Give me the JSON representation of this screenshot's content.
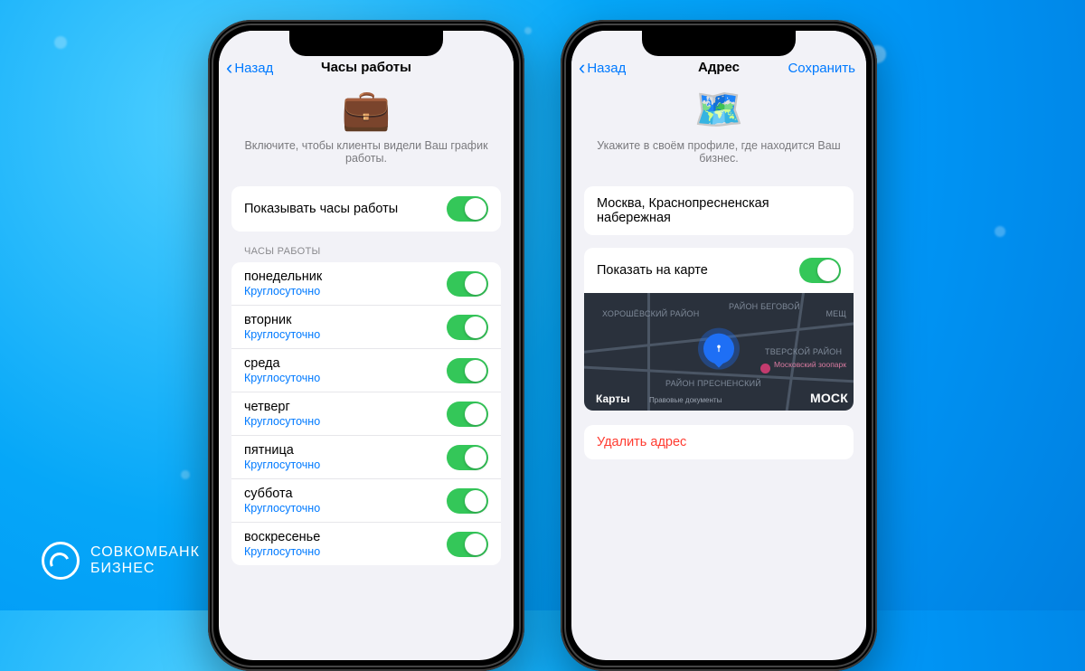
{
  "branding": {
    "name": "СОВКОМБАНК",
    "sub": "БИЗНЕС"
  },
  "phone1": {
    "nav": {
      "back": "Назад",
      "title": "Часы работы"
    },
    "hero": {
      "icon": "💼",
      "text": "Включите, чтобы клиенты видели Ваш график работы."
    },
    "toggle_label": "Показывать часы работы",
    "section_label": "ЧАСЫ РАБОТЫ",
    "days": [
      {
        "name": "понедельник",
        "sub": "Круглосуточно"
      },
      {
        "name": "вторник",
        "sub": "Круглосуточно"
      },
      {
        "name": "среда",
        "sub": "Круглосуточно"
      },
      {
        "name": "четверг",
        "sub": "Круглосуточно"
      },
      {
        "name": "пятница",
        "sub": "Круглосуточно"
      },
      {
        "name": "суббота",
        "sub": "Круглосуточно"
      },
      {
        "name": "воскресенье",
        "sub": "Круглосуточно"
      }
    ]
  },
  "phone2": {
    "nav": {
      "back": "Назад",
      "title": "Адрес",
      "save": "Сохранить"
    },
    "hero": {
      "icon": "🗺️",
      "text": "Укажите в своём профиле, где находится Ваш бизнес."
    },
    "address": "Москва, Краснопресненская набережная",
    "map_toggle": "Показать на карте",
    "map": {
      "brand": "Карты",
      "fine": "Правовые документы",
      "city": "Моск",
      "districts": [
        "ХОРОШЁВСКИЙ РАЙОН",
        "РАЙОН БЕГОВОЙ",
        "ТВЕРСКОЙ РАЙОН",
        "РАЙОН ПРЕСНЕНСКИЙ",
        "МЕЩ"
      ],
      "poi": "Московский зоопарк"
    },
    "delete": "Удалить адрес"
  }
}
